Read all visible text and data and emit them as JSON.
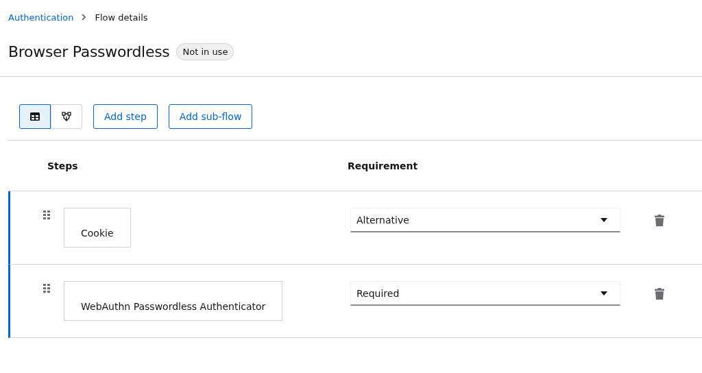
{
  "breadcrumb": [
    {
      "label": "Authentication",
      "link": true
    },
    {
      "label": "Flow details",
      "link": false
    }
  ],
  "title": "Browser Passwordless",
  "status_badge": "Not in use",
  "view_toggle": [
    {
      "kind": "table",
      "selected": true
    },
    {
      "kind": "diagram",
      "selected": false
    }
  ],
  "buttons": [
    "Add step",
    "Add sub-flow"
  ],
  "table": {
    "columns": [
      "Steps",
      "Requirement"
    ],
    "rows": [
      {
        "step": "Cookie",
        "requirement": "Alternative"
      },
      {
        "step": "WebAuthn Passwordless Authenticator",
        "requirement": "Required"
      }
    ]
  }
}
